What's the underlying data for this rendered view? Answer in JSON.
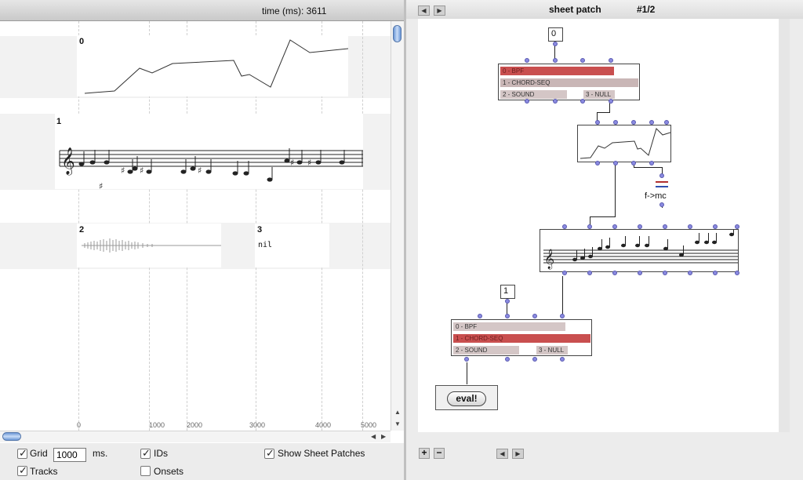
{
  "left_pane": {
    "time_label": "time (ms): 3611",
    "tracks": [
      {
        "id": "0",
        "kind": "bpf-curve"
      },
      {
        "id": "1",
        "kind": "chord-seq-score"
      },
      {
        "id": "2",
        "kind": "sound-waveform"
      },
      {
        "id": "3",
        "kind": "null",
        "value": "nil"
      }
    ],
    "ticks": [
      "0",
      "1000",
      "2000",
      "3000",
      "4000",
      "5000"
    ],
    "controls": {
      "grid": {
        "label": "Grid",
        "checked": true,
        "value": "1000",
        "unit": "ms."
      },
      "tracks": {
        "label": "Tracks",
        "checked": true
      },
      "ids": {
        "label": "IDs",
        "checked": true
      },
      "onsets": {
        "label": "Onsets",
        "checked": false
      },
      "show_sheet_patches": {
        "label": "Show Sheet Patches",
        "checked": true
      }
    }
  },
  "right_pane": {
    "title": "sheet patch",
    "page": "#1/2",
    "top_number": "0",
    "second_number": "1",
    "selector_top": {
      "items": [
        "0 - BPF",
        "1 - CHORD-SEQ",
        "2 - SOUND",
        "3 - NULL"
      ],
      "selected": "0 - BPF"
    },
    "selector_bottom": {
      "items": [
        "0 - BPF",
        "1 - CHORD-SEQ",
        "2 - SOUND",
        "3 - NULL"
      ],
      "selected": "1 - CHORD-SEQ"
    },
    "fmc_label": "f->mc",
    "eval_label": "eval!"
  },
  "icons": {
    "nav_left": "arrow-left-icon",
    "nav_right": "arrow-right-icon",
    "add": "plus-icon",
    "remove": "minus-icon"
  },
  "colors": {
    "selected_bar": "#c94f4f",
    "inlet": "#8a8ae0"
  }
}
